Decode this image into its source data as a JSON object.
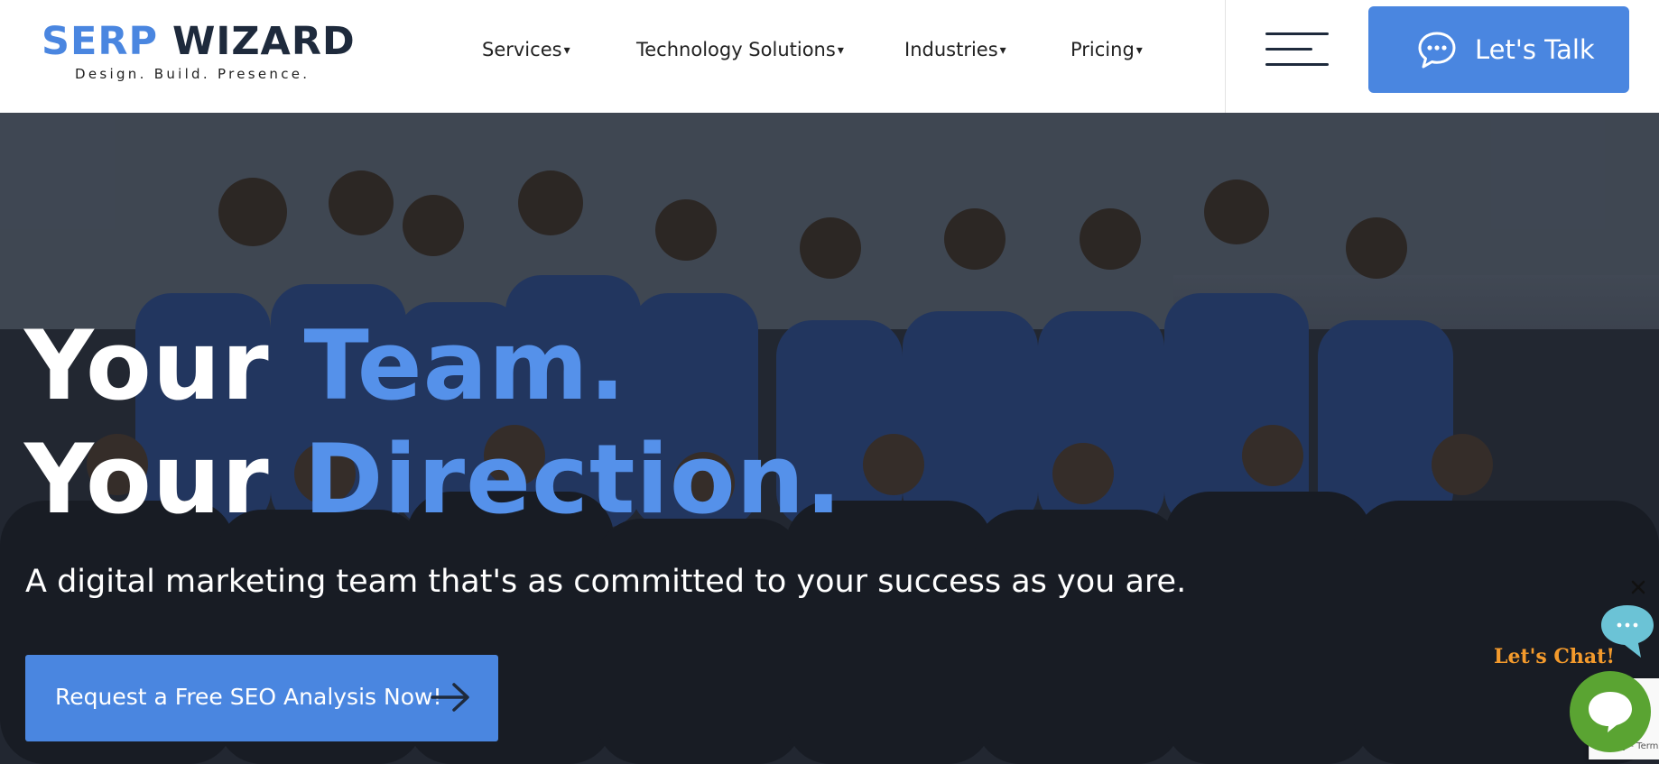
{
  "brand": {
    "logo_part1": "SERP",
    "logo_part2": "WIZARD",
    "tagline": "Design. Build. Presence.",
    "primary_color": "#4a86e0",
    "dark_color": "#1e2a3c"
  },
  "nav": {
    "items": [
      {
        "label": "Services",
        "icon": "caret-down-icon"
      },
      {
        "label": "Technology Solutions",
        "icon": "caret-down-icon"
      },
      {
        "label": "Industries",
        "icon": "caret-down-icon"
      },
      {
        "label": "Pricing",
        "icon": "caret-down-icon"
      }
    ],
    "caret": "▾",
    "menu_icon": "hamburger-menu-icon"
  },
  "header_cta": {
    "label": "Let's Talk",
    "icon": "chat-bubble-icon"
  },
  "hero": {
    "line1_white": "Your ",
    "line1_blue": "Team.",
    "line2_white": "Your ",
    "line2_blue": "Direction.",
    "subtitle": "A digital marketing team that's as committed to your success as you are.",
    "cta_label": "Request a Free SEO Analysis Now!",
    "cta_icon": "arrow-right-icon",
    "accent_color": "#5591ea"
  },
  "chat_widget": {
    "prompt": "Let's Chat!",
    "close_icon": "close-icon",
    "bubble_icon": "chat-bubble-icon",
    "launcher_icon": "chat-launcher-icon",
    "launcher_color": "#5aa432",
    "prompt_color": "#f39a2c"
  },
  "recaptcha": {
    "text": "Privacy - Terms"
  }
}
